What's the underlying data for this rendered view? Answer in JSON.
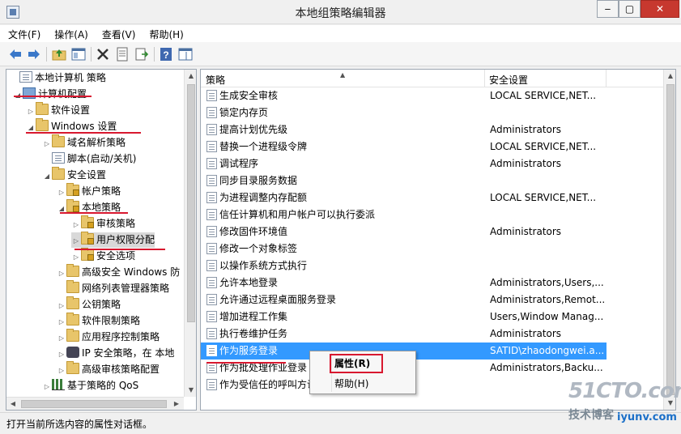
{
  "window": {
    "title": "本地组策略编辑器",
    "min": "‒",
    "max": "▢",
    "close": "✕"
  },
  "menu": [
    "文件(F)",
    "操作(A)",
    "查看(V)",
    "帮助(H)"
  ],
  "tree": {
    "items": [
      {
        "label": "本地计算机 策略",
        "icon": "doc-icon",
        "exp": ""
      },
      {
        "label": "计算机配置",
        "icon": "computer-icon",
        "exp": "◢"
      },
      {
        "label": "软件设置",
        "icon": "folder-icon",
        "exp": "▷"
      },
      {
        "label": "Windows 设置",
        "icon": "folder-icon",
        "exp": "◢"
      },
      {
        "label": "域名解析策略",
        "icon": "folder-icon",
        "exp": "▷"
      },
      {
        "label": "脚本(启动/关机)",
        "icon": "doc-icon",
        "exp": ""
      },
      {
        "label": "安全设置",
        "icon": "folder-icon",
        "exp": "◢"
      },
      {
        "label": "帐户策略",
        "icon": "lock-folder-icon",
        "exp": "▷"
      },
      {
        "label": "本地策略",
        "icon": "lock-folder-icon",
        "exp": "◢"
      },
      {
        "label": "审核策略",
        "icon": "lock-folder-icon",
        "exp": "▷"
      },
      {
        "label": "用户权限分配",
        "icon": "lock-folder-icon",
        "exp": "▷"
      },
      {
        "label": "安全选项",
        "icon": "lock-folder-icon",
        "exp": "▷"
      },
      {
        "label": "高级安全 Windows 防",
        "icon": "folder-icon",
        "exp": "▷"
      },
      {
        "label": "网络列表管理器策略",
        "icon": "folder-icon",
        "exp": ""
      },
      {
        "label": "公钥策略",
        "icon": "folder-icon",
        "exp": "▷"
      },
      {
        "label": "软件限制策略",
        "icon": "folder-icon",
        "exp": "▷"
      },
      {
        "label": "应用程序控制策略",
        "icon": "folder-icon",
        "exp": "▷"
      },
      {
        "label": "IP 安全策略，在 本地",
        "icon": "shield-icon",
        "exp": "▷"
      },
      {
        "label": "高级审核策略配置",
        "icon": "folder-icon",
        "exp": "▷"
      },
      {
        "label": "基于策略的 QoS",
        "icon": "chart-icon",
        "exp": "▷"
      }
    ]
  },
  "list": {
    "col_policy": "策略",
    "col_setting": "安全设置",
    "rows": [
      {
        "name": "生成安全审核",
        "setting": "LOCAL SERVICE,NET..."
      },
      {
        "name": "锁定内存页",
        "setting": ""
      },
      {
        "name": "提高计划优先级",
        "setting": "Administrators"
      },
      {
        "name": "替换一个进程级令牌",
        "setting": "LOCAL SERVICE,NET..."
      },
      {
        "name": "调试程序",
        "setting": "Administrators"
      },
      {
        "name": "同步目录服务数据",
        "setting": ""
      },
      {
        "name": "为进程调整内存配额",
        "setting": "LOCAL SERVICE,NET..."
      },
      {
        "name": "信任计算机和用户帐户可以执行委派",
        "setting": ""
      },
      {
        "name": "修改固件环境值",
        "setting": "Administrators"
      },
      {
        "name": "修改一个对象标签",
        "setting": ""
      },
      {
        "name": "以操作系统方式执行",
        "setting": ""
      },
      {
        "name": "允许本地登录",
        "setting": "Administrators,Users,..."
      },
      {
        "name": "允许通过远程桌面服务登录",
        "setting": "Administrators,Remot..."
      },
      {
        "name": "增加进程工作集",
        "setting": "Users,Window Manag..."
      },
      {
        "name": "执行卷维护任务",
        "setting": "Administrators"
      },
      {
        "name": "作为服务登录",
        "setting": "SATID\\zhaodongwei.a..."
      },
      {
        "name": "作为批处理作业登录",
        "setting": "Administrators,Backu..."
      },
      {
        "name": "作为受信任的呼叫方访",
        "setting": ""
      }
    ],
    "selected_index": 15
  },
  "context_menu": {
    "properties": "属性(R)",
    "help": "帮助(H)"
  },
  "status": {
    "text": "打开当前所选内容的属性对话框。"
  },
  "watermark": {
    "line1": "51CTO.com",
    "line2": "技术博客",
    "line3": "iyunv.com"
  }
}
